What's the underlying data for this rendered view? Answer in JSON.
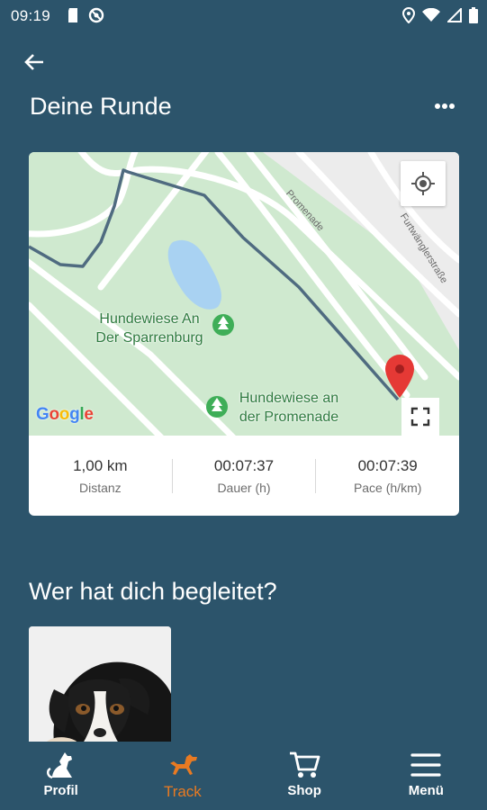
{
  "status_bar": {
    "time": "09:19"
  },
  "page": {
    "title": "Deine Runde"
  },
  "map": {
    "labels": [
      {
        "text": "Hundewiese An\nDer Sparrenburg"
      },
      {
        "text": "Hundewiese an\nder Promenade"
      }
    ],
    "streets": [
      "Promenade",
      "Furtwänglerstraße"
    ],
    "google_logo": "Google"
  },
  "stats": [
    {
      "value": "1,00 km",
      "label": "Distanz"
    },
    {
      "value": "00:07:37",
      "label": "Dauer (h)"
    },
    {
      "value": "00:07:39",
      "label": "Pace (h/km)"
    }
  ],
  "companions": {
    "title": "Wer hat dich begleitet?"
  },
  "nav": {
    "items": [
      {
        "label": "Profil",
        "icon": "dog-sitting-icon"
      },
      {
        "label": "Track",
        "icon": "dog-running-icon",
        "active": true
      },
      {
        "label": "Shop",
        "icon": "shopping-cart-icon"
      },
      {
        "label": "Menü",
        "icon": "hamburger-menu-icon"
      }
    ],
    "active_color": "#e87a22"
  },
  "colors": {
    "background": "#2c546b",
    "accent": "#e87a22",
    "route": "#4f6b80",
    "pin": "#e53935"
  }
}
